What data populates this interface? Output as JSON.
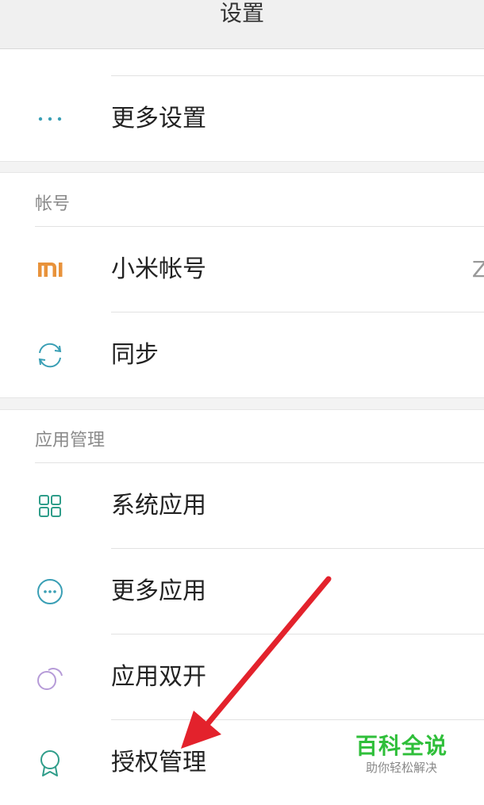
{
  "header": {
    "title": "设置"
  },
  "top_group": {
    "items": [
      {
        "label": "更多设置",
        "icon": "more-dots-icon"
      }
    ]
  },
  "account_section": {
    "title": "帐号",
    "items": [
      {
        "label": "小米帐号",
        "icon": "mi-logo-icon",
        "trailing": "Z"
      },
      {
        "label": "同步",
        "icon": "sync-icon"
      }
    ]
  },
  "apps_section": {
    "title": "应用管理",
    "items": [
      {
        "label": "系统应用",
        "icon": "grid-icon"
      },
      {
        "label": "更多应用",
        "icon": "more-apps-icon"
      },
      {
        "label": "应用双开",
        "icon": "dual-apps-icon"
      },
      {
        "label": "授权管理",
        "icon": "badge-icon"
      }
    ]
  },
  "watermark": {
    "title": "百科全说",
    "subtitle": "助你轻松解决"
  },
  "colors": {
    "accent_teal": "#3a9fb5",
    "mi_orange": "#e8923a",
    "dual_purple": "#b69bd8",
    "annotation_red": "#e3222c",
    "watermark_green": "#2fbf3a"
  }
}
